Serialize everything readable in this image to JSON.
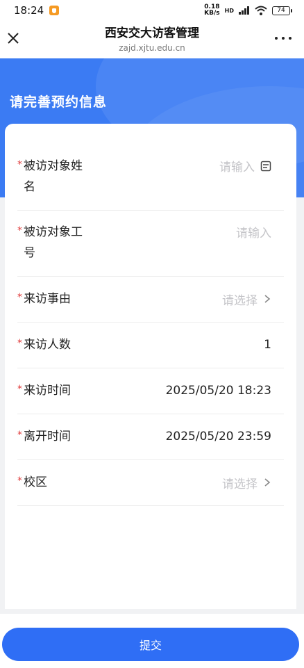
{
  "status_bar": {
    "time": "18:24",
    "net_speed_value": "0.18",
    "net_speed_unit": "KB/s",
    "network_label": "HD",
    "battery": "74"
  },
  "header": {
    "title": "西安交大访客管理",
    "url": "zajd.xjtu.edu.cn"
  },
  "hero": {
    "title": "请完善预约信息"
  },
  "form": {
    "fields": [
      {
        "label_line1": "被访对象姓",
        "label_line2": "名",
        "value": "请输入",
        "is_placeholder": true
      },
      {
        "label_line1": "被访对象工",
        "label_line2": "号",
        "value": "请输入",
        "is_placeholder": true
      },
      {
        "label_line1": "来访事由",
        "value": "请选择",
        "is_placeholder": true
      },
      {
        "label_line1": "来访人数",
        "value": "1",
        "is_placeholder": false
      },
      {
        "label_line1": "来访时间",
        "value": "2025/05/20 18:23",
        "is_placeholder": false
      },
      {
        "label_line1": "离开时间",
        "value": "2025/05/20 23:59",
        "is_placeholder": false
      },
      {
        "label_line1": "校区",
        "value": "请选择",
        "is_placeholder": true
      }
    ],
    "required_mark": "*"
  },
  "actions": {
    "submit_label": "提交"
  },
  "colors": {
    "primary": "#2f6ef5",
    "hero_bg": "#3b7bf3",
    "required": "#e03c3c",
    "placeholder": "#c4c4c8"
  }
}
